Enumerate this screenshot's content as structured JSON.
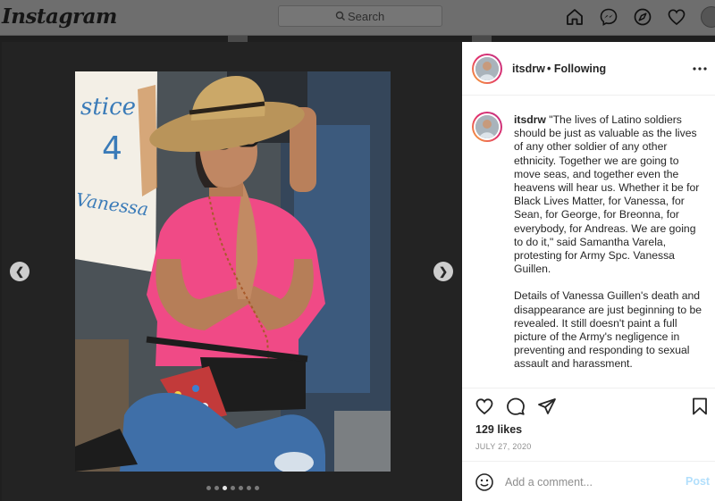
{
  "topbar": {
    "logo": "Instagram",
    "search_placeholder": "Search",
    "icons": [
      "home-icon",
      "messenger-icon",
      "explore-icon",
      "heart-icon",
      "profile-avatar"
    ]
  },
  "post": {
    "username": "itsdrw",
    "following_label": "• Following",
    "caption_paragraphs": [
      "\"The lives of Latino soldiers should be just as valuable as the lives of any other soldier of any other ethnicity. Together we are going to move seas, and together even the heavens will hear us. Whether it be for Black Lives Matter, for Vanessa, for Sean, for George, for Breonna, for everybody, for Andreas. We are going to do it,\" said Samantha Varela, protesting for Army Spc. Vanessa Guillen.",
      "Details of Vanessa Guillen's death and disappearance are just beginning to be revealed. It still doesn't paint a full picture of the Army's negligence in preventing and responding to sexual assault and harassment."
    ],
    "likes": "129 likes",
    "date": "JULY 27, 2020",
    "comment_placeholder": "Add a comment...",
    "post_button": "Post",
    "carousel": {
      "slide_count": 7,
      "active_index": 2
    },
    "sign_text": [
      "stice",
      "4",
      "Vanessa"
    ]
  },
  "colors": {
    "accent_blue_disabled": "#b2dffc",
    "shirt_pink": "#f04a86",
    "ring_gradient": [
      "#f9b233",
      "#e1306c",
      "#c13584"
    ]
  }
}
